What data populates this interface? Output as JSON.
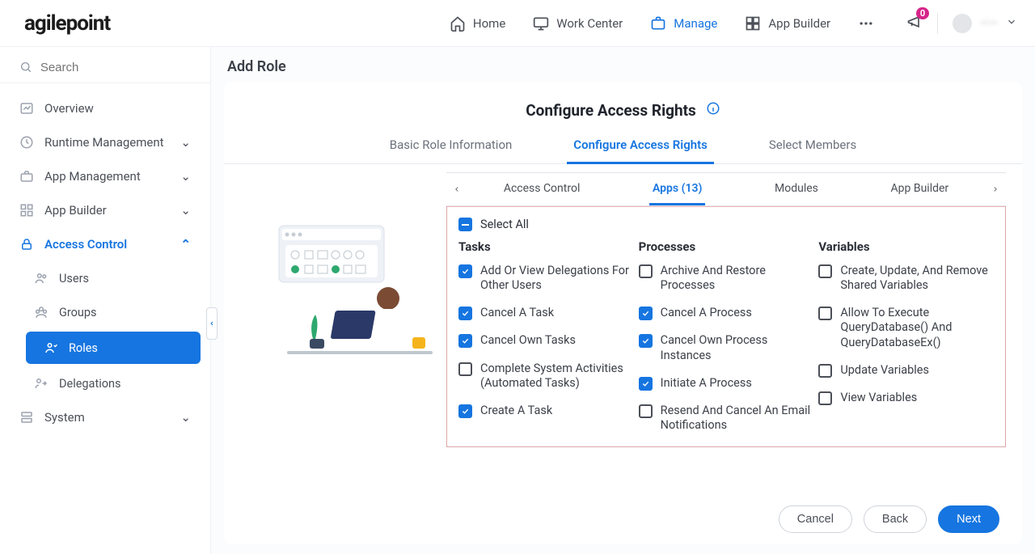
{
  "brand": "agilepoint",
  "topnav": {
    "home": "Home",
    "workcenter": "Work Center",
    "manage": "Manage",
    "appbuilder": "App Builder"
  },
  "notification_count": "0",
  "username": "——",
  "sidebar": {
    "search_placeholder": "Search",
    "items": [
      {
        "label": "Overview"
      },
      {
        "label": "Runtime Management"
      },
      {
        "label": "App Management"
      },
      {
        "label": "App Builder"
      },
      {
        "label": "Access Control"
      },
      {
        "label": "System"
      }
    ],
    "access_control_items": [
      {
        "label": "Users"
      },
      {
        "label": "Groups"
      },
      {
        "label": "Roles"
      },
      {
        "label": "Delegations"
      }
    ]
  },
  "main": {
    "page_title": "Add Role",
    "section_title": "Configure Access Rights",
    "wizard_tabs": [
      {
        "label": "Basic Role Information"
      },
      {
        "label": "Configure Access Rights"
      },
      {
        "label": "Select Members"
      }
    ],
    "subtabs": [
      {
        "label": "Access Control"
      },
      {
        "label": "Apps (13)"
      },
      {
        "label": "Modules"
      },
      {
        "label": "App Builder"
      }
    ],
    "select_all_label": "Select All",
    "columns": {
      "tasks": {
        "title": "Tasks",
        "items": [
          {
            "label": "Add Or View Delegations For Other Users",
            "checked": true
          },
          {
            "label": "Cancel A Task",
            "checked": true
          },
          {
            "label": "Cancel Own Tasks",
            "checked": true
          },
          {
            "label": "Complete System Activities (Automated Tasks)",
            "checked": false
          },
          {
            "label": "Create A Task",
            "checked": true
          }
        ]
      },
      "processes": {
        "title": "Processes",
        "items": [
          {
            "label": "Archive And Restore Processes",
            "checked": false
          },
          {
            "label": "Cancel A Process",
            "checked": true
          },
          {
            "label": "Cancel Own Process Instances",
            "checked": true
          },
          {
            "label": "Initiate A Process",
            "checked": true
          },
          {
            "label": "Resend And Cancel An Email Notifications",
            "checked": false
          }
        ]
      },
      "variables": {
        "title": "Variables",
        "items": [
          {
            "label": "Create, Update, And Remove Shared Variables",
            "checked": false
          },
          {
            "label": "Allow To Execute QueryDatabase() And QueryDatabaseEx()",
            "checked": false
          },
          {
            "label": "Update Variables",
            "checked": false
          },
          {
            "label": "View Variables",
            "checked": false
          }
        ]
      }
    },
    "buttons": {
      "cancel": "Cancel",
      "back": "Back",
      "next": "Next"
    }
  }
}
